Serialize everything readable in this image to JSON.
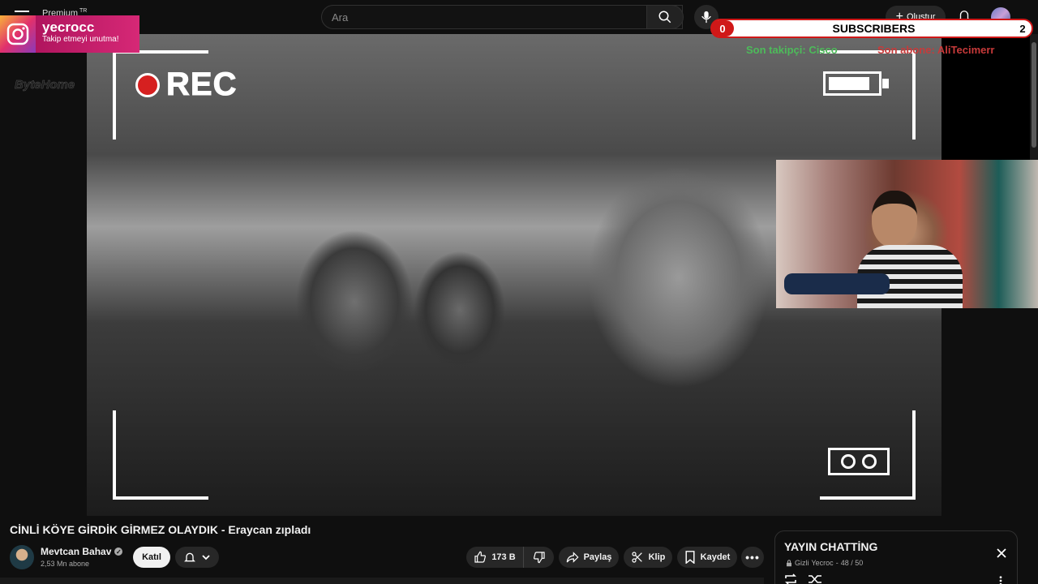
{
  "topbar": {
    "logo_text": "Premium",
    "logo_region": "TR",
    "search_placeholder": "Ara",
    "create_label": "Oluştur"
  },
  "overlay": {
    "instagram_handle": "yecrocc",
    "instagram_sub": "Takip etmeyi unutma!",
    "rec_label": "REC",
    "subscribers_label": "SUBSCRIBERS",
    "subscribers_left": "0",
    "subscribers_right": "2",
    "last_follower_label": "Son takipçi:",
    "last_follower_name": "Cisco",
    "last_sub_label": "Son abone:",
    "last_sub_name": "AliTecimerr",
    "logo_watermark": "ByteHome"
  },
  "video": {
    "title": "CİNLİ KÖYE GİRDİK GİRMEZ OLAYDIK - Eraycan zıpladı"
  },
  "channel": {
    "name": "Mevtcan Bahav",
    "subscribers": "2,53 Mn abone",
    "join_label": "Katıl"
  },
  "actions": {
    "likes": "173 B",
    "share_label": "Paylaş",
    "clip_label": "Klip",
    "save_label": "Kaydet"
  },
  "chat": {
    "title": "YAYIN CHATTİNG",
    "visibility": "Gizli",
    "owner": "Yecroc",
    "count": "48 / 50"
  },
  "colors": {
    "background": "#0f0f0f",
    "rec_red": "#d62020",
    "follower_green": "#4dbb5a",
    "subscriber_red": "#c83a3a",
    "instagram_pink": "#d62876"
  }
}
